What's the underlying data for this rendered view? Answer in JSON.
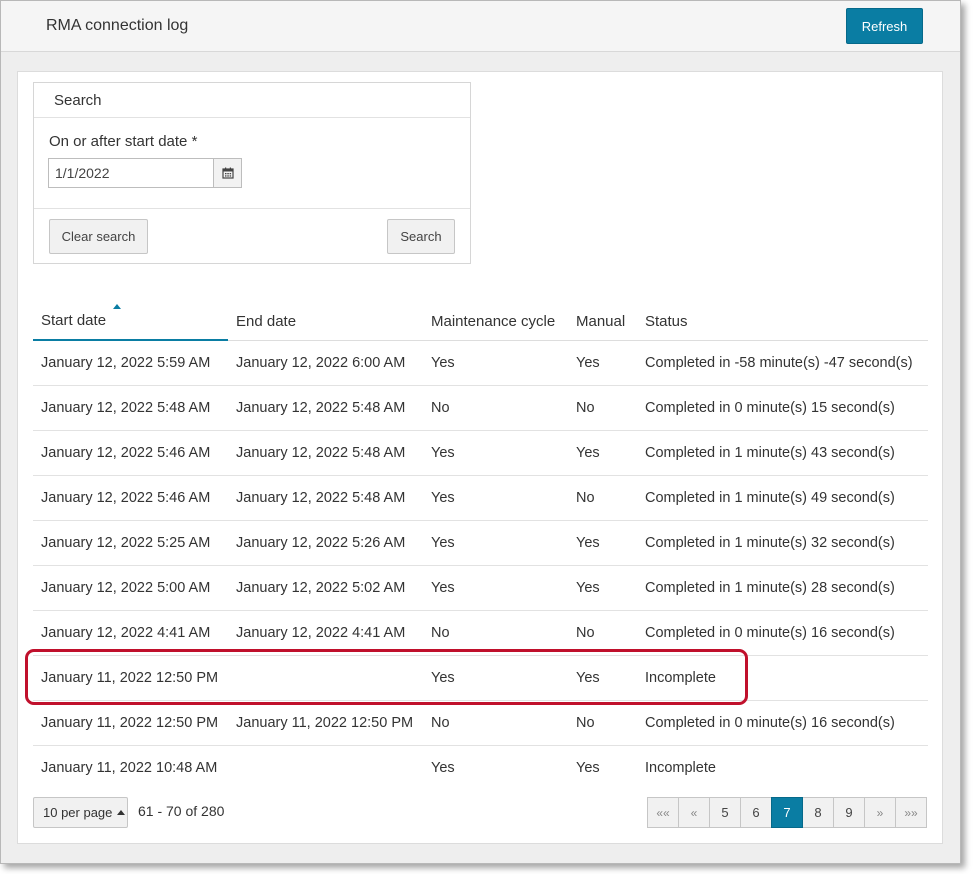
{
  "header": {
    "title": "RMA connection log",
    "refresh_label": "Refresh"
  },
  "search": {
    "panel_title": "Search",
    "field_label": "On or after start date *",
    "date_value": "1/1/2022",
    "clear_label": "Clear search",
    "search_label": "Search"
  },
  "table": {
    "columns": [
      "Start date",
      "End date",
      "Maintenance cycle",
      "Manual",
      "Status"
    ],
    "sorted_column": "Start date",
    "rows": [
      {
        "start": "January 12, 2022 5:59 AM",
        "end": "January 12, 2022 6:00 AM",
        "maintenance": "Yes",
        "manual": "Yes",
        "status": "Completed in -58 minute(s) -47 second(s)"
      },
      {
        "start": "January 12, 2022 5:48 AM",
        "end": "January 12, 2022 5:48 AM",
        "maintenance": "No",
        "manual": "No",
        "status": "Completed in 0 minute(s) 15 second(s)"
      },
      {
        "start": "January 12, 2022 5:46 AM",
        "end": "January 12, 2022 5:48 AM",
        "maintenance": "Yes",
        "manual": "Yes",
        "status": "Completed in 1 minute(s) 43 second(s)"
      },
      {
        "start": "January 12, 2022 5:46 AM",
        "end": "January 12, 2022 5:48 AM",
        "maintenance": "Yes",
        "manual": "No",
        "status": "Completed in 1 minute(s) 49 second(s)"
      },
      {
        "start": "January 12, 2022 5:25 AM",
        "end": "January 12, 2022 5:26 AM",
        "maintenance": "Yes",
        "manual": "Yes",
        "status": "Completed in 1 minute(s) 32 second(s)"
      },
      {
        "start": "January 12, 2022 5:00 AM",
        "end": "January 12, 2022 5:02 AM",
        "maintenance": "Yes",
        "manual": "Yes",
        "status": "Completed in 1 minute(s) 28 second(s)"
      },
      {
        "start": "January 12, 2022 4:41 AM",
        "end": "January 12, 2022 4:41 AM",
        "maintenance": "No",
        "manual": "No",
        "status": "Completed in 0 minute(s) 16 second(s)"
      },
      {
        "start": "January 11, 2022 12:50 PM",
        "end": "",
        "maintenance": "Yes",
        "manual": "Yes",
        "status": "Incomplete"
      },
      {
        "start": "January 11, 2022 12:50 PM",
        "end": "January 11, 2022 12:50 PM",
        "maintenance": "No",
        "manual": "No",
        "status": "Completed in 0 minute(s) 16 second(s)"
      },
      {
        "start": "January 11, 2022 10:48 AM",
        "end": "",
        "maintenance": "Yes",
        "manual": "Yes",
        "status": "Incomplete"
      }
    ]
  },
  "pagination": {
    "per_page_label": "10 per page",
    "range_text": "61 - 70 of 280",
    "first": "««",
    "prev": "«",
    "pages": [
      "5",
      "6",
      "7",
      "8",
      "9"
    ],
    "active_page": "7",
    "next": "»",
    "last": "»»"
  },
  "colors": {
    "accent": "#0a7da3",
    "highlight": "#c0102c"
  }
}
